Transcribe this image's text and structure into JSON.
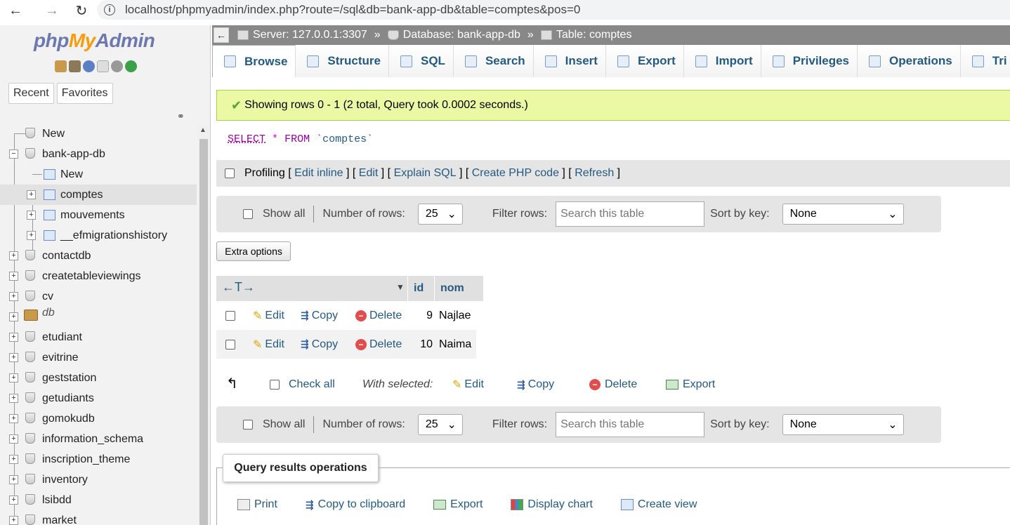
{
  "browser": {
    "url": "localhost/phpmyadmin/index.php?route=/sql&db=bank-app-db&table=comptes&pos=0"
  },
  "logo": {
    "php": "php",
    "my": "My",
    "admin": "Admin"
  },
  "sidebar": {
    "tabs": [
      "Recent",
      "Favorites"
    ],
    "tree": [
      {
        "label": "New"
      },
      {
        "label": "bank-app-db"
      },
      {
        "label": "New"
      },
      {
        "label": "comptes"
      },
      {
        "label": "mouvements"
      },
      {
        "label": "__efmigrationshistory"
      },
      {
        "label": "contactdb"
      },
      {
        "label": "createtableviewings"
      },
      {
        "label": "cv"
      },
      {
        "label": "db"
      },
      {
        "label": "etudiant"
      },
      {
        "label": "evitrine"
      },
      {
        "label": "geststation"
      },
      {
        "label": "getudiants"
      },
      {
        "label": "gomokudb"
      },
      {
        "label": "information_schema"
      },
      {
        "label": "inscription_theme"
      },
      {
        "label": "inventory"
      },
      {
        "label": "lsibdd"
      },
      {
        "label": "market"
      }
    ]
  },
  "breadcrumb": {
    "server": "Server: 127.0.0.1:3307",
    "database": "Database: bank-app-db",
    "table": "Table: comptes",
    "sep": "»"
  },
  "tabs": [
    "Browse",
    "Structure",
    "SQL",
    "Search",
    "Insert",
    "Export",
    "Import",
    "Privileges",
    "Operations",
    "Tri"
  ],
  "message": "Showing rows 0 - 1 (2 total, Query took 0.0002 seconds.)",
  "sql": {
    "select": "SELECT",
    "star": "*",
    "from": "FROM",
    "table": "`comptes`"
  },
  "profiling": {
    "label": "Profiling",
    "links": [
      "Edit inline",
      "Edit",
      "Explain SQL",
      "Create PHP code",
      "Refresh"
    ]
  },
  "nav": {
    "show_all": "Show all",
    "num_rows_label": "Number of rows:",
    "num_rows": "25",
    "filter_label": "Filter rows:",
    "filter_placeholder": "Search this table",
    "sort_label": "Sort by key:",
    "sort_value": "None"
  },
  "extra_options": "Extra options",
  "table": {
    "columns": [
      "id",
      "nom"
    ],
    "rows": [
      {
        "id": "9",
        "nom": "Najlae"
      },
      {
        "id": "10",
        "nom": "Naima"
      }
    ],
    "actions": {
      "edit": "Edit",
      "copy": "Copy",
      "delete": "Delete"
    }
  },
  "bulk": {
    "check_all": "Check all",
    "with_selected": "With selected:",
    "edit": "Edit",
    "copy": "Copy",
    "delete": "Delete",
    "export": "Export"
  },
  "query_ops": {
    "title": "Query results operations",
    "items": [
      "Print",
      "Copy to clipboard",
      "Export",
      "Display chart",
      "Create view"
    ]
  }
}
